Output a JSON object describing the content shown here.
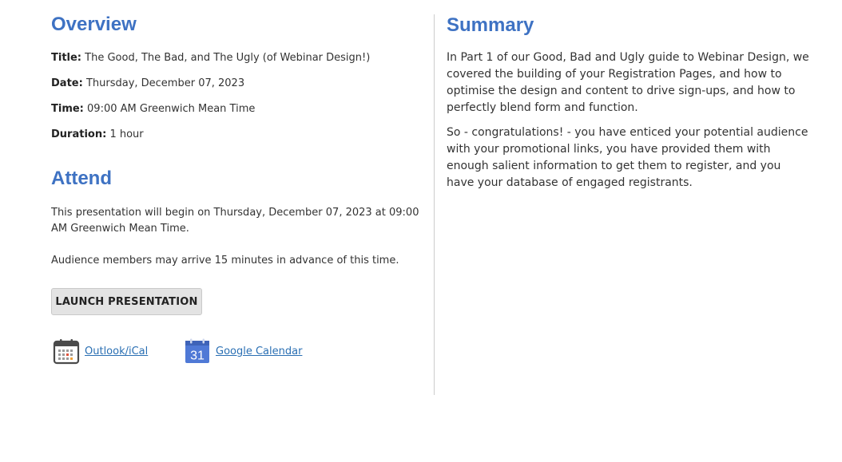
{
  "overview": {
    "heading": "Overview",
    "title_key": "Title:",
    "title_value": "The Good, The Bad, and The Ugly (of Webinar Design!)",
    "date_key": "Date:",
    "date_value": "Thursday, December 07, 2023",
    "time_key": "Time:",
    "time_value": "09:00 AM Greenwich Mean Time",
    "duration_key": "Duration:",
    "duration_value": "1 hour"
  },
  "attend": {
    "heading": "Attend",
    "begin_text": "This presentation will begin on Thursday, December 07, 2023 at 09:00 AM Greenwich Mean Time.",
    "arrive_text": "Audience members may arrive 15 minutes in advance of this time.",
    "launch_label": "LAUNCH PRESENTATION",
    "outlook_label": "Outlook/iCal",
    "outlook_icon": "calendar-icon",
    "google_label": "Google Calendar",
    "google_icon": "google-calendar-icon",
    "google_icon_day": "31"
  },
  "summary": {
    "heading": "Summary",
    "para1": "In Part 1 of our Good, Bad and Ugly guide to Webinar Design, we covered the building of your Registration Pages, and how to optimise the design and content to drive sign-ups, and how to perfectly blend form and function.",
    "para2": "So - congratulations! - you have enticed your potential audience with your promotional links, you have provided them with enough salient information to get them to register, and you have your database of engaged registrants."
  },
  "colors": {
    "heading": "#3e72c3",
    "link": "#2a6fb3",
    "button_bg": "#e3e3e3",
    "divider": "#cccccc"
  }
}
